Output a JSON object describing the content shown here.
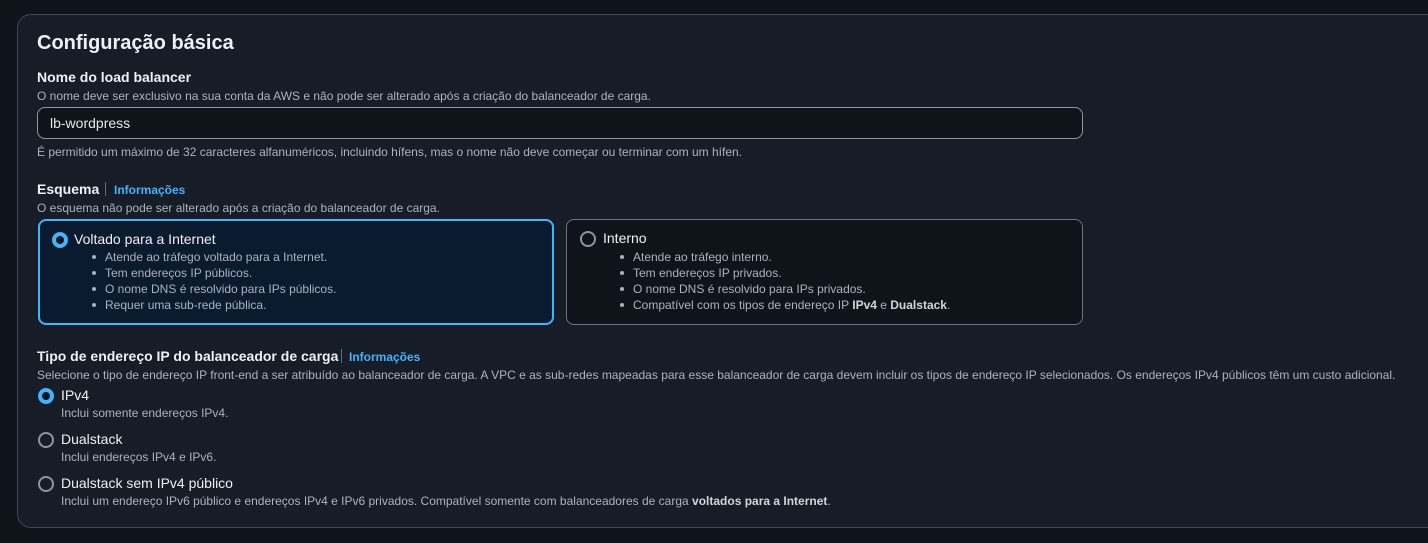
{
  "section": {
    "title": "Configuração básica"
  },
  "name_field": {
    "label": "Nome do load balancer",
    "description": "O nome deve ser exclusivo na sua conta da AWS e não pode ser alterado após a criação do balanceador de carga.",
    "value": "lb-wordpress",
    "hint": "É permitido um máximo de 32 caracteres alfanuméricos, incluindo hífens, mas o nome não deve começar ou terminar com um hífen."
  },
  "scheme": {
    "label": "Esquema",
    "info_link": "Informações",
    "description": "O esquema não pode ser alterado após a criação do balanceador de carga.",
    "selected": "internet-facing",
    "options": [
      {
        "title": "Voltado para a Internet",
        "bullets": [
          "Atende ao tráfego voltado para a Internet.",
          "Tem endereços IP públicos.",
          "O nome DNS é resolvido para IPs públicos.",
          "Requer uma sub-rede pública."
        ]
      },
      {
        "title": "Interno",
        "bullets": [
          "Atende ao tráfego interno.",
          "Tem endereços IP privados.",
          "O nome DNS é resolvido para IPs privados."
        ],
        "last_bullet": {
          "prefix": "Compatível com os tipos de endereço IP ",
          "bold1": "IPv4",
          "mid": " e ",
          "bold2": "Dualstack",
          "suffix": "."
        }
      }
    ]
  },
  "ip_type": {
    "label": "Tipo de endereço IP do balanceador de carga",
    "info_link": "Informações",
    "description": "Selecione o tipo de endereço IP front-end a ser atribuído ao balanceador de carga. A VPC e as sub-redes mapeadas para esse balanceador de carga devem incluir os tipos de endereço IP selecionados. Os endereços IPv4 públicos têm um custo adicional.",
    "selected": "IPv4",
    "options": [
      {
        "title": "IPv4",
        "description": "Inclui somente endereços IPv4."
      },
      {
        "title": "Dualstack",
        "description": "Inclui endereços IPv4 e IPv6."
      },
      {
        "title": "Dualstack sem IPv4 público",
        "description_prefix": "Inclui um endereço IPv6 público e endereços IPv4 e IPv6 privados. Compatível somente com balanceadores de carga ",
        "description_bold": "voltados para a Internet",
        "description_suffix": "."
      }
    ]
  },
  "colors": {
    "accent": "#42b4ff",
    "panel": "#161d26",
    "background": "#0f141a"
  }
}
